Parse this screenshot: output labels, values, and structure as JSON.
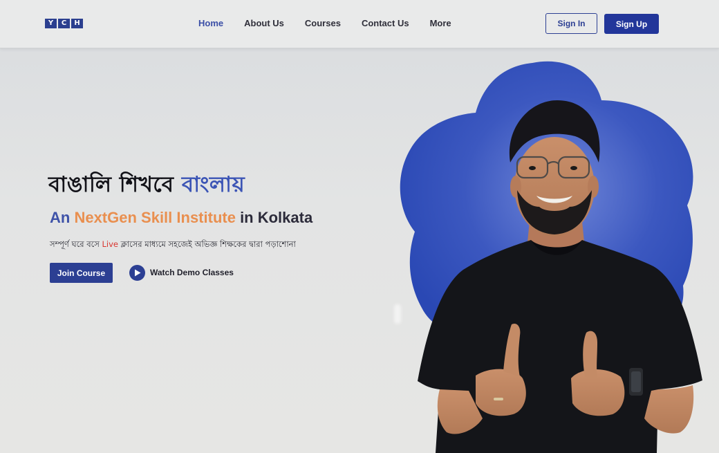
{
  "brand": {
    "logo_letters": [
      "Y",
      "C",
      "H"
    ]
  },
  "nav": {
    "links": [
      {
        "label": "Home",
        "active": true
      },
      {
        "label": "About Us",
        "active": false
      },
      {
        "label": "Courses",
        "active": false
      },
      {
        "label": "Contact Us",
        "active": false
      },
      {
        "label": "More",
        "active": false
      }
    ],
    "sign_in": "Sign In",
    "sign_up": "Sign Up"
  },
  "hero": {
    "heading_part1": "বাঙালি শিখবে ",
    "heading_part2": "বাংলায়",
    "sub_part1": "An ",
    "sub_part2": "NextGen Skill Institute",
    "sub_part3": " in Kolkata",
    "desc_part1": "সম্পূর্ণ ঘরে বসে ",
    "desc_live": "Live",
    "desc_part2": " ক্লাসের মাধ্যমে সহজেই অভিজ্ঞ শিক্ষকের দ্বারা পড়াশোনা",
    "join_button": "Join Course",
    "watch_demo": "Watch Demo Classes"
  },
  "colors": {
    "brand_blue": "#2c3f93",
    "accent_blue": "#3b54b5",
    "accent_orange": "#e98f4f",
    "live_red": "#d9352f",
    "blob_blue": "#2f4fb8"
  }
}
